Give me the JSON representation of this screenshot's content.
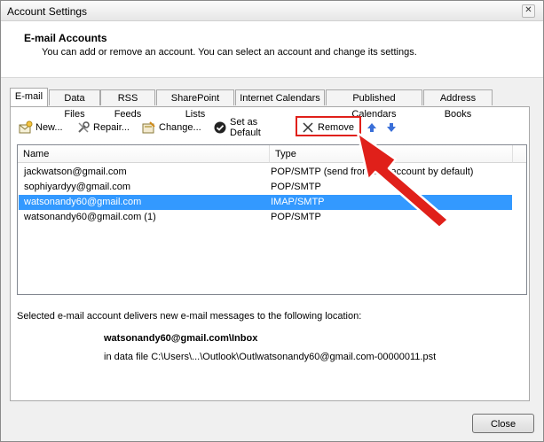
{
  "window": {
    "title": "Account Settings",
    "close_glyph": "✕"
  },
  "header": {
    "title": "E-mail Accounts",
    "description": "You can add or remove an account. You can select an account and change its settings."
  },
  "tabs": [
    {
      "label": "E-mail",
      "active": true
    },
    {
      "label": "Data Files",
      "active": false
    },
    {
      "label": "RSS Feeds",
      "active": false
    },
    {
      "label": "SharePoint Lists",
      "active": false
    },
    {
      "label": "Internet Calendars",
      "active": false
    },
    {
      "label": "Published Calendars",
      "active": false
    },
    {
      "label": "Address Books",
      "active": false
    }
  ],
  "toolbar": {
    "new_label": "New...",
    "repair_label": "Repair...",
    "change_label": "Change...",
    "set_default_label": "Set as Default",
    "remove_label": "Remove",
    "move_up_icon": "arrow-up-icon",
    "move_down_icon": "arrow-down-icon"
  },
  "accounts_table": {
    "columns": [
      "Name",
      "Type"
    ],
    "rows": [
      {
        "name": "jackwatson@gmail.com",
        "type": "POP/SMTP (send from this account by default)",
        "selected": false
      },
      {
        "name": "sophiyardyy@gmail.com",
        "type": "POP/SMTP",
        "selected": false
      },
      {
        "name": "watsonandy60@gmail.com",
        "type": "IMAP/SMTP",
        "selected": true
      },
      {
        "name": "watsonandy60@gmail.com (1)",
        "type": "POP/SMTP",
        "selected": false
      }
    ]
  },
  "delivery": {
    "intro": "Selected e-mail account delivers new e-mail messages to the following location:",
    "folder": "watsonandy60@gmail.com\\Inbox",
    "data_file": "in data file C:\\Users\\...\\Outlook\\Outlwatsonandy60@gmail.com-00000011.pst"
  },
  "footer": {
    "close_label": "Close"
  },
  "colors": {
    "selection": "#3399ff",
    "annotation_red": "#e0201a"
  }
}
